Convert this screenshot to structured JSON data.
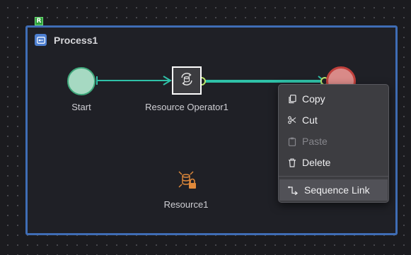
{
  "canvas": {
    "marker_label": "R"
  },
  "process": {
    "title": "Process1",
    "icon": "process-key-icon",
    "border_color": "#3f6db5"
  },
  "nodes": {
    "start": {
      "label": "Start",
      "fill": "#a6d9c2",
      "stroke": "#3fa87b"
    },
    "task": {
      "label": "Resource Operator1",
      "icon": "resource-operator-icon"
    },
    "end": {
      "fill": "#d98a88",
      "stroke": "#c0403c"
    },
    "resource": {
      "label": "Resource1",
      "icon": "database-lock-icon",
      "color": "#e0893a"
    }
  },
  "connections": {
    "color": "#2fc1a8",
    "selected_handle_color": "#b7e36a"
  },
  "context_menu": {
    "items": [
      {
        "label": "Copy",
        "icon": "copy-icon",
        "enabled": true
      },
      {
        "label": "Cut",
        "icon": "scissors-icon",
        "enabled": true
      },
      {
        "label": "Paste",
        "icon": "paste-icon",
        "enabled": false
      },
      {
        "label": "Delete",
        "icon": "trash-icon",
        "enabled": true
      }
    ],
    "extra_item": {
      "label": "Sequence Link",
      "icon": "sequence-link-icon",
      "highlighted": true
    }
  }
}
